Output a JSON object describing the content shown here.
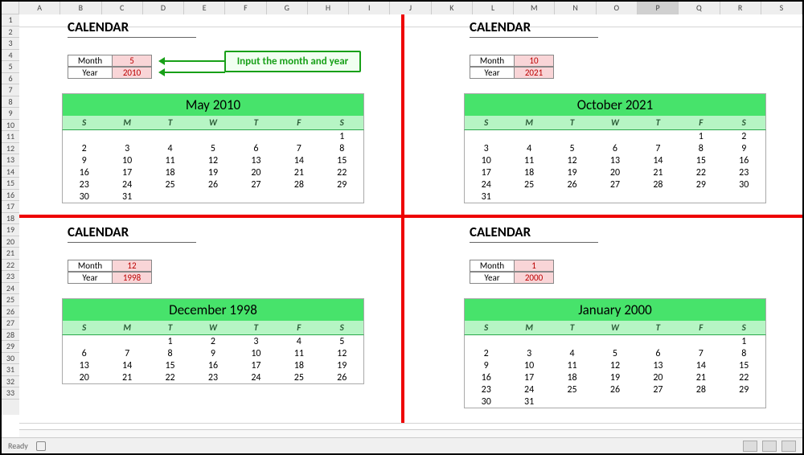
{
  "status": {
    "ready": "Ready"
  },
  "columns": [
    "A",
    "B",
    "C",
    "D",
    "E",
    "F",
    "G",
    "H",
    "I",
    "J",
    "K",
    "L",
    "M",
    "N",
    "O",
    "P",
    "Q",
    "R",
    "S"
  ],
  "selected_col": "P",
  "rows": [
    1,
    2,
    3,
    4,
    5,
    6,
    7,
    8,
    9,
    10,
    11,
    12,
    13,
    14,
    15,
    16,
    17,
    18,
    19,
    20,
    21,
    22,
    23,
    24,
    25,
    26,
    27,
    28,
    29,
    30,
    31,
    32,
    33
  ],
  "callout": "Input the month and year",
  "panes": {
    "tl": {
      "title": "CALENDAR",
      "month_label": "Month",
      "month_val": "5",
      "year_label": "Year",
      "year_val": "2010",
      "cal_title": "May 2010",
      "days": [
        "S",
        "M",
        "T",
        "W",
        "T",
        "F",
        "S"
      ],
      "grid": [
        [
          "",
          "",
          "",
          "",
          "",
          "",
          "1"
        ],
        [
          "2",
          "3",
          "4",
          "5",
          "6",
          "7",
          "8"
        ],
        [
          "9",
          "10",
          "11",
          "12",
          "13",
          "14",
          "15"
        ],
        [
          "16",
          "17",
          "18",
          "19",
          "20",
          "21",
          "22"
        ],
        [
          "23",
          "24",
          "25",
          "26",
          "27",
          "28",
          "29"
        ],
        [
          "30",
          "31",
          "",
          "",
          "",
          "",
          ""
        ]
      ]
    },
    "tr": {
      "title": "CALENDAR",
      "month_label": "Month",
      "month_val": "10",
      "year_label": "Year",
      "year_val": "2021",
      "cal_title": "October 2021",
      "days": [
        "S",
        "M",
        "T",
        "W",
        "T",
        "F",
        "S"
      ],
      "grid": [
        [
          "",
          "",
          "",
          "",
          "",
          "1",
          "2"
        ],
        [
          "3",
          "4",
          "5",
          "6",
          "7",
          "8",
          "9"
        ],
        [
          "10",
          "11",
          "12",
          "13",
          "14",
          "15",
          "16"
        ],
        [
          "17",
          "18",
          "19",
          "20",
          "21",
          "22",
          "23"
        ],
        [
          "24",
          "25",
          "26",
          "27",
          "28",
          "29",
          "30"
        ],
        [
          "31",
          "",
          "",
          "",
          "",
          "",
          ""
        ]
      ]
    },
    "bl": {
      "title": "CALENDAR",
      "month_label": "Month",
      "month_val": "12",
      "year_label": "Year",
      "year_val": "1998",
      "cal_title": "December 1998",
      "days": [
        "S",
        "M",
        "T",
        "W",
        "T",
        "F",
        "S"
      ],
      "grid": [
        [
          "",
          "",
          "1",
          "2",
          "3",
          "4",
          "5"
        ],
        [
          "6",
          "7",
          "8",
          "9",
          "10",
          "11",
          "12"
        ],
        [
          "13",
          "14",
          "15",
          "16",
          "17",
          "18",
          "19"
        ],
        [
          "20",
          "21",
          "22",
          "23",
          "24",
          "25",
          "26"
        ]
      ]
    },
    "br": {
      "title": "CALENDAR",
      "month_label": "Month",
      "month_val": "1",
      "year_label": "Year",
      "year_val": "2000",
      "cal_title": "January 2000",
      "days": [
        "S",
        "M",
        "T",
        "W",
        "T",
        "F",
        "S"
      ],
      "grid": [
        [
          "",
          "",
          "",
          "",
          "",
          "",
          "1"
        ],
        [
          "2",
          "3",
          "4",
          "5",
          "6",
          "7",
          "8"
        ],
        [
          "9",
          "10",
          "11",
          "12",
          "13",
          "14",
          "15"
        ],
        [
          "16",
          "17",
          "18",
          "19",
          "20",
          "21",
          "22"
        ],
        [
          "23",
          "24",
          "25",
          "26",
          "27",
          "28",
          "29"
        ],
        [
          "30",
          "31",
          "",
          "",
          "",
          "",
          ""
        ]
      ]
    }
  }
}
